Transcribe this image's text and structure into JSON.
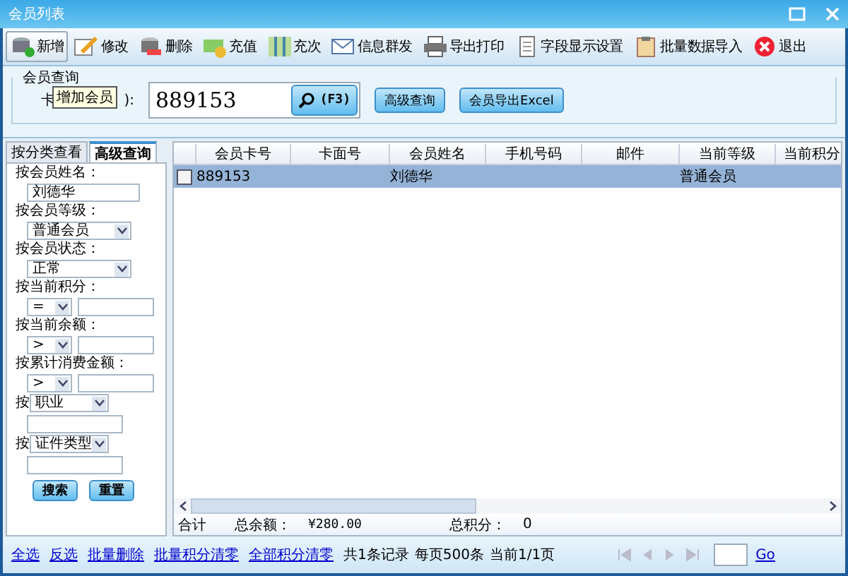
{
  "window": {
    "title": "会员列表"
  },
  "toolbar": [
    {
      "label": "新增",
      "kind": "add",
      "selected": true
    },
    {
      "label": "修改",
      "kind": "edit",
      "selected": false
    },
    {
      "label": "删除",
      "kind": "delete",
      "selected": false
    },
    {
      "label": "充值",
      "kind": "money",
      "selected": false
    },
    {
      "label": "充次",
      "kind": "map",
      "selected": false
    },
    {
      "label": "信息群发",
      "kind": "mail",
      "selected": false
    },
    {
      "label": "导出打印",
      "kind": "print",
      "selected": false
    },
    {
      "label": "字段显示设置",
      "kind": "doc",
      "selected": false
    },
    {
      "label": "批量数据导入",
      "kind": "clipboard",
      "selected": false
    },
    {
      "label": "退出",
      "kind": "exit",
      "selected": false
    }
  ],
  "query": {
    "title": "会员查询",
    "label_start": "卡",
    "label_end": "):",
    "value": "889153",
    "search_button": "(F3)",
    "buttons": [
      "高级查询",
      "会员导出Excel"
    ],
    "tooltip": "增加会员"
  },
  "side_tabs": [
    {
      "label": "按分类查看",
      "selected": false
    },
    {
      "label": "高级查询",
      "selected": true
    }
  ],
  "filters": [
    {
      "kind": "text",
      "label": "按会员姓名：",
      "value": "刘德华"
    },
    {
      "kind": "select",
      "label": "按会员等级：",
      "value": "普通会员"
    },
    {
      "kind": "select",
      "label": "按会员状态：",
      "value": "正常"
    },
    {
      "kind": "compare",
      "label": "按当前积分：",
      "operator": "="
    },
    {
      "kind": "compare",
      "label": "按当前余额：",
      "operator": ">"
    },
    {
      "kind": "compare",
      "label": "按累计消费金额：",
      "operator": ">"
    },
    {
      "kind": "field",
      "label": "按",
      "value": "职业"
    },
    {
      "kind": "field",
      "label": "按",
      "value": "证件类型"
    }
  ],
  "filter_buttons": [
    "搜索",
    "重置"
  ],
  "table": {
    "columns": [
      "会员卡号",
      "卡面号",
      "会员姓名",
      "手机号码",
      "邮件",
      "当前等级",
      "当前积分"
    ],
    "rows": [
      {
        "checked": false,
        "selected": true,
        "card_no": "889153",
        "name": "刘德华",
        "level": "普通会员"
      }
    ]
  },
  "totals": {
    "label": "合计",
    "balance_label": "总余额：",
    "balance": "¥280.00",
    "points_label": "总积分：",
    "points": "0"
  },
  "footer": {
    "links": [
      "全选",
      "反选",
      "批量删除",
      "批量积分清零",
      "全部积分清零"
    ],
    "info": [
      "共1条记录",
      "每页500条",
      "当前1/1页"
    ],
    "go": "Go"
  }
}
